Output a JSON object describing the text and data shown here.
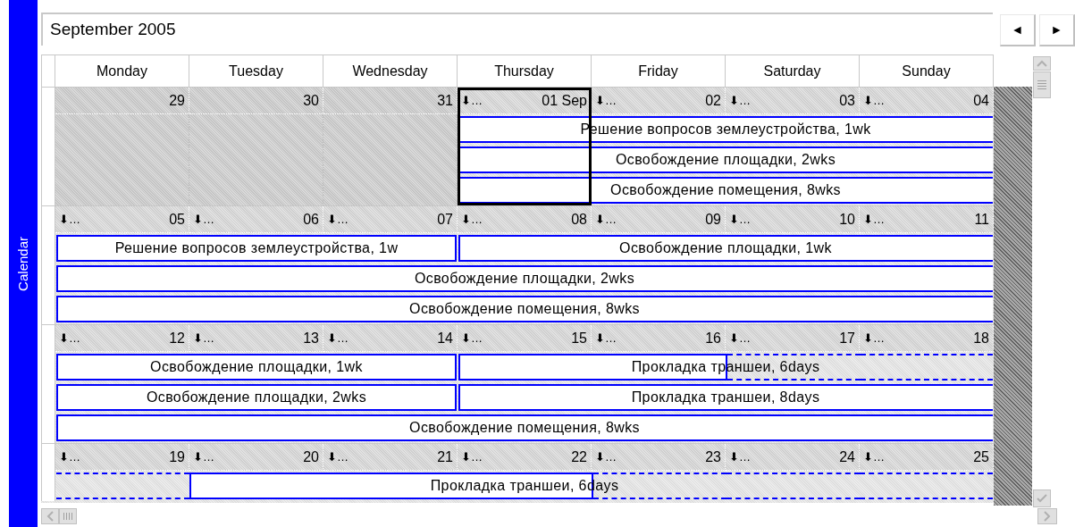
{
  "sidebar": {
    "label": "Calendar"
  },
  "header": {
    "title": "September 2005",
    "nav_buttons": [
      "◄",
      "►"
    ]
  },
  "weekdays": [
    "Monday",
    "Tuesday",
    "Wednesday",
    "Thursday",
    "Friday",
    "Saturday",
    "Sunday"
  ],
  "weeks": [
    {
      "days": [
        {
          "label": "29",
          "in_month": false,
          "selected": false
        },
        {
          "label": "30",
          "in_month": false,
          "selected": false
        },
        {
          "label": "31",
          "in_month": false,
          "selected": false
        },
        {
          "more": "⬇…",
          "label": "01 Sep",
          "in_month": true,
          "selected": true
        },
        {
          "more": "⬇…",
          "label": "02",
          "in_month": true,
          "selected": false
        },
        {
          "more": "⬇…",
          "label": "03",
          "in_month": true,
          "selected": false
        },
        {
          "more": "⬇…",
          "label": "04",
          "in_month": true,
          "selected": false
        }
      ],
      "rows": [
        {
          "cells": [
            {
              "kind": "empty"
            },
            {
              "kind": "empty"
            },
            {
              "kind": "empty"
            },
            {
              "kind": "begin"
            },
            {
              "kind": "solid"
            },
            {
              "kind": "solid"
            },
            {
              "kind": "solid"
            }
          ],
          "events": [
            {
              "text": "Решение вопросов землеустройства, 1wk"
            }
          ]
        },
        {
          "cells": [
            {
              "kind": "empty"
            },
            {
              "kind": "empty"
            },
            {
              "kind": "empty"
            },
            {
              "kind": "begin"
            },
            {
              "kind": "solid"
            },
            {
              "kind": "solid"
            },
            {
              "kind": "solid"
            }
          ],
          "events": [
            {
              "text": "Освобождение площадки, 2wks"
            }
          ]
        },
        {
          "cells": [
            {
              "kind": "empty"
            },
            {
              "kind": "empty"
            },
            {
              "kind": "empty"
            },
            {
              "kind": "begin"
            },
            {
              "kind": "solid"
            },
            {
              "kind": "solid"
            },
            {
              "kind": "solid"
            }
          ],
          "events": [
            {
              "text": "Освобождение помещения, 8wks"
            }
          ]
        }
      ]
    },
    {
      "days": [
        {
          "more": "⬇…",
          "label": "05",
          "in_month": true,
          "selected": false
        },
        {
          "more": "⬇…",
          "label": "06",
          "in_month": true,
          "selected": false
        },
        {
          "more": "⬇…",
          "label": "07",
          "in_month": true,
          "selected": false
        },
        {
          "more": "⬇…",
          "label": "08",
          "in_month": true,
          "selected": false
        },
        {
          "more": "⬇…",
          "label": "09",
          "in_month": true,
          "selected": false
        },
        {
          "more": "⬇…",
          "label": "10",
          "in_month": true,
          "selected": false
        },
        {
          "more": "⬇…",
          "label": "11",
          "in_month": true,
          "selected": false
        }
      ],
      "rows": [
        {
          "cells": [
            {
              "kind": "begin"
            },
            {
              "kind": "solid"
            },
            {
              "kind": "solid"
            },
            {
              "kind": "begin"
            },
            {
              "kind": "solid"
            },
            {
              "kind": "solid"
            },
            {
              "kind": "solid"
            }
          ],
          "events": [
            {
              "text": "Решение вопросов землеустройства, 1w"
            },
            {
              "text": "Освобождение площадки, 1wk"
            }
          ]
        },
        {
          "cells": [
            {
              "kind": "begin"
            },
            {
              "kind": "solid"
            },
            {
              "kind": "solid"
            },
            {
              "kind": "solid"
            },
            {
              "kind": "solid"
            },
            {
              "kind": "solid"
            },
            {
              "kind": "solid"
            }
          ],
          "events": [
            {
              "text": "Освобождение площадки, 2wks"
            }
          ]
        },
        {
          "cells": [
            {
              "kind": "begin"
            },
            {
              "kind": "solid"
            },
            {
              "kind": "solid"
            },
            {
              "kind": "solid"
            },
            {
              "kind": "solid"
            },
            {
              "kind": "solid"
            },
            {
              "kind": "solid"
            }
          ],
          "events": [
            {
              "text": "Освобождение помещения, 8wks"
            }
          ]
        }
      ]
    },
    {
      "days": [
        {
          "more": "⬇…",
          "label": "12",
          "in_month": true,
          "selected": false
        },
        {
          "more": "⬇…",
          "label": "13",
          "in_month": true,
          "selected": false
        },
        {
          "more": "⬇…",
          "label": "14",
          "in_month": true,
          "selected": false
        },
        {
          "more": "⬇…",
          "label": "15",
          "in_month": true,
          "selected": false
        },
        {
          "more": "⬇…",
          "label": "16",
          "in_month": true,
          "selected": false
        },
        {
          "more": "⬇…",
          "label": "17",
          "in_month": true,
          "selected": false
        },
        {
          "more": "⬇…",
          "label": "18",
          "in_month": true,
          "selected": false
        }
      ],
      "rows": [
        {
          "cells": [
            {
              "kind": "begin"
            },
            {
              "kind": "solid"
            },
            {
              "kind": "solid"
            },
            {
              "kind": "begin"
            },
            {
              "kind": "solid"
            },
            {
              "kind": "dashed"
            },
            {
              "kind": "dashed"
            }
          ],
          "events": [
            {
              "text": "Освобождение площадки, 1wk"
            },
            {
              "text": "Прокладка траншеи, 6days"
            }
          ]
        },
        {
          "cells": [
            {
              "kind": "begin"
            },
            {
              "kind": "solid"
            },
            {
              "kind": "solid"
            },
            {
              "kind": "begin"
            },
            {
              "kind": "solid"
            },
            {
              "kind": "solid"
            },
            {
              "kind": "solid"
            }
          ],
          "events": [
            {
              "text": "Освобождение площадки, 2wks"
            },
            {
              "text": "Прокладка траншеи, 8days"
            }
          ]
        },
        {
          "cells": [
            {
              "kind": "begin"
            },
            {
              "kind": "solid"
            },
            {
              "kind": "solid"
            },
            {
              "kind": "solid"
            },
            {
              "kind": "solid"
            },
            {
              "kind": "solid"
            },
            {
              "kind": "solid"
            }
          ],
          "events": [
            {
              "text": "Освобождение помещения, 8wks"
            }
          ]
        }
      ]
    },
    {
      "days": [
        {
          "more": "⬇…",
          "label": "19",
          "in_month": true,
          "selected": false
        },
        {
          "more": "⬇…",
          "label": "20",
          "in_month": true,
          "selected": false
        },
        {
          "more": "⬇…",
          "label": "21",
          "in_month": true,
          "selected": false
        },
        {
          "more": "⬇…",
          "label": "22",
          "in_month": true,
          "selected": false
        },
        {
          "more": "⬇…",
          "label": "23",
          "in_month": true,
          "selected": false
        },
        {
          "more": "⬇…",
          "label": "24",
          "in_month": true,
          "selected": false
        },
        {
          "more": "⬇…",
          "label": "25",
          "in_month": true,
          "selected": false
        }
      ],
      "rows": [
        {
          "cells": [
            {
              "kind": "dashed"
            },
            {
              "kind": "solid"
            },
            {
              "kind": "solid"
            },
            {
              "kind": "solid"
            },
            {
              "kind": "dashed"
            },
            {
              "kind": "dashed"
            },
            {
              "kind": "dashed"
            }
          ],
          "events": [
            {
              "text": "Прокладка траншеи, 6days"
            }
          ]
        }
      ]
    }
  ]
}
